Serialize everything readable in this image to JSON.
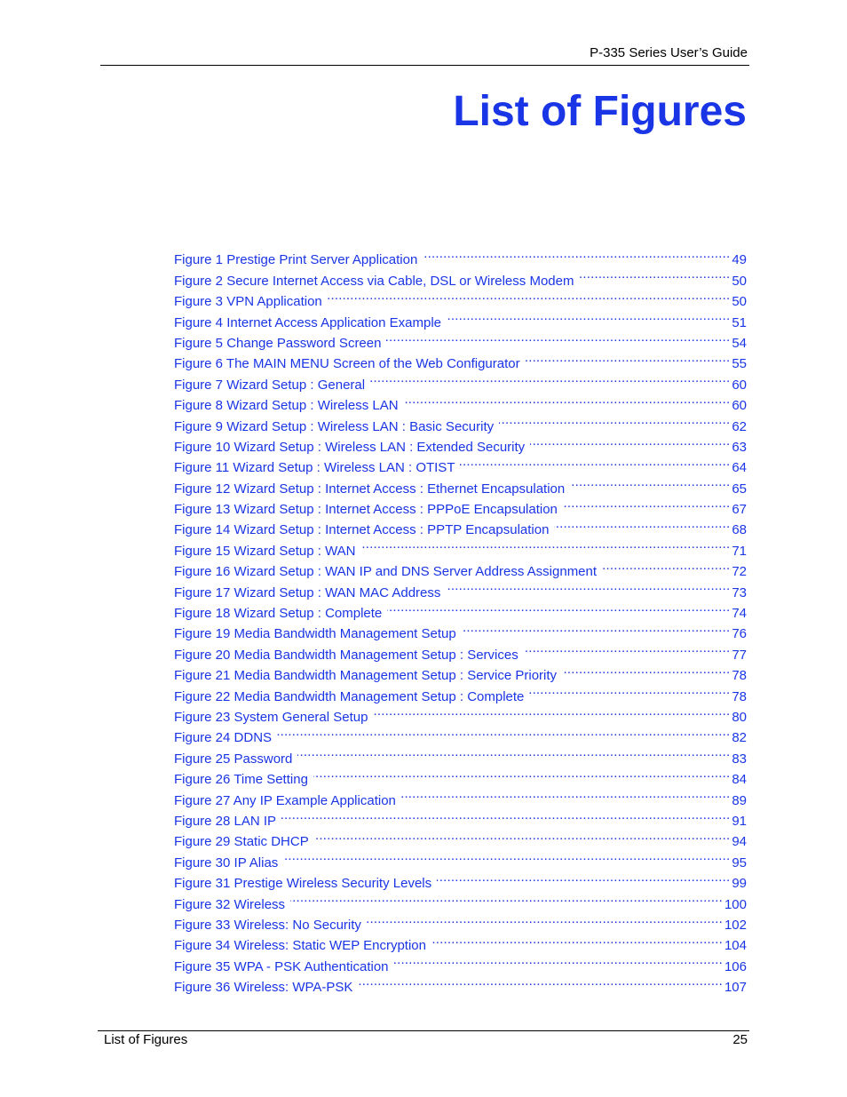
{
  "header": {
    "guide_title": "P-335 Series User’s Guide"
  },
  "page_title": "List of Figures",
  "colors": {
    "link": "#1a35e6",
    "text": "#000000"
  },
  "figures": [
    {
      "title": "Figure 1 Prestige Print Server Application",
      "page": "49"
    },
    {
      "title": "Figure 2 Secure Internet Access via Cable, DSL or Wireless Modem",
      "page": "50"
    },
    {
      "title": "Figure 3 VPN Application",
      "page": "50"
    },
    {
      "title": "Figure 4 Internet Access Application Example",
      "page": "51"
    },
    {
      "title": "Figure 5 Change Password Screen",
      "page": "54"
    },
    {
      "title": "Figure 6 The MAIN MENU Screen of the Web Configurator",
      "page": "55"
    },
    {
      "title": "Figure 7 Wizard Setup : General",
      "page": "60"
    },
    {
      "title": "Figure 8 Wizard Setup : Wireless LAN",
      "page": "60"
    },
    {
      "title": "Figure 9 Wizard Setup : Wireless LAN : Basic Security",
      "page": "62"
    },
    {
      "title": "Figure 10 Wizard Setup : Wireless LAN : Extended Security",
      "page": "63"
    },
    {
      "title": "Figure 11 Wizard Setup : Wireless LAN : OTIST",
      "page": "64"
    },
    {
      "title": "Figure 12 Wizard Setup : Internet Access : Ethernet Encapsulation",
      "page": "65"
    },
    {
      "title": "Figure 13 Wizard Setup : Internet Access : PPPoE Encapsulation",
      "page": "67"
    },
    {
      "title": "Figure 14 Wizard Setup : Internet Access : PPTP Encapsulation",
      "page": "68"
    },
    {
      "title": "Figure 15 Wizard Setup : WAN",
      "page": "71"
    },
    {
      "title": "Figure 16 Wizard Setup : WAN IP and DNS Server Address Assignment",
      "page": "72"
    },
    {
      "title": "Figure 17 Wizard Setup : WAN MAC Address",
      "page": "73"
    },
    {
      "title": "Figure 18 Wizard Setup : Complete",
      "page": "74"
    },
    {
      "title": "Figure 19 Media Bandwidth Management Setup",
      "page": "76"
    },
    {
      "title": "Figure 20 Media Bandwidth Management Setup : Services",
      "page": "77"
    },
    {
      "title": "Figure 21 Media Bandwidth Management Setup : Service Priority",
      "page": "78"
    },
    {
      "title": "Figure 22 Media Bandwidth Management Setup : Complete",
      "page": "78"
    },
    {
      "title": "Figure 23 System General Setup",
      "page": "80"
    },
    {
      "title": "Figure 24 DDNS",
      "page": "82"
    },
    {
      "title": "Figure 25 Password",
      "page": "83"
    },
    {
      "title": "Figure 26 Time Setting",
      "page": "84"
    },
    {
      "title": "Figure 27 Any IP Example Application",
      "page": "89"
    },
    {
      "title": "Figure 28 LAN IP",
      "page": "91"
    },
    {
      "title": "Figure 29 Static DHCP",
      "page": "94"
    },
    {
      "title": "Figure 30 IP Alias",
      "page": "95"
    },
    {
      "title": "Figure 31 Prestige Wireless Security Levels",
      "page": "99"
    },
    {
      "title": "Figure 32 Wireless",
      "page": "100"
    },
    {
      "title": "Figure 33 Wireless: No Security",
      "page": "102"
    },
    {
      "title": "Figure 34 Wireless: Static WEP Encryption",
      "page": "104"
    },
    {
      "title": "Figure 35 WPA - PSK Authentication",
      "page": "106"
    },
    {
      "title": "Figure 36 Wireless: WPA-PSK",
      "page": "107"
    }
  ],
  "footer": {
    "section": "List of Figures",
    "page_number": "25"
  }
}
